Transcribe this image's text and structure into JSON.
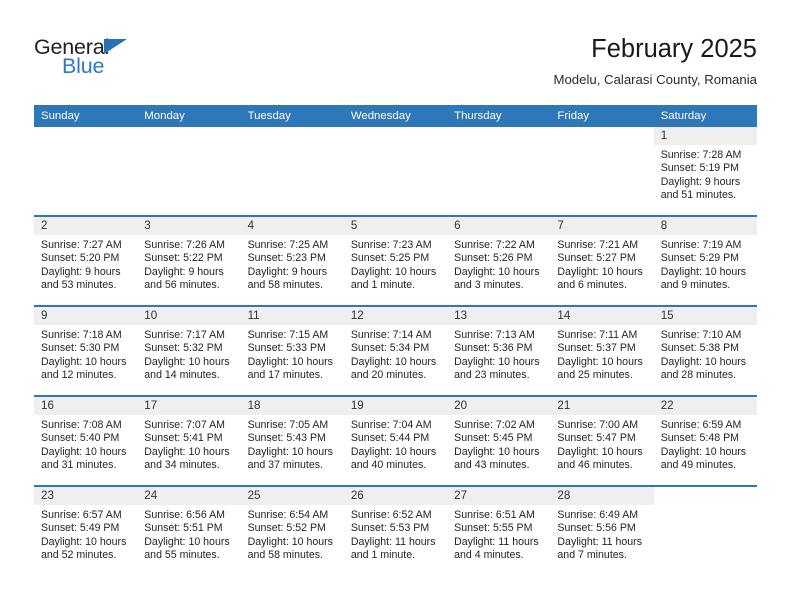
{
  "brand": {
    "word_dark": "General",
    "word_blue": "Blue",
    "accent_color": "#2e77b9",
    "logo_icon": "triangle-icon"
  },
  "header": {
    "title": "February 2025",
    "subtitle": "Modelu, Calarasi County, Romania"
  },
  "calendar": {
    "weekday_headers": [
      "Sunday",
      "Monday",
      "Tuesday",
      "Wednesday",
      "Thursday",
      "Friday",
      "Saturday"
    ],
    "header_bg": "#2e77b9",
    "daynum_band_bg": "#efefef",
    "weeks": [
      [
        {
          "day": "",
          "blank": true
        },
        {
          "day": "",
          "blank": true
        },
        {
          "day": "",
          "blank": true
        },
        {
          "day": "",
          "blank": true
        },
        {
          "day": "",
          "blank": true
        },
        {
          "day": "",
          "blank": true
        },
        {
          "day": "1",
          "sunrise": "Sunrise: 7:28 AM",
          "sunset": "Sunset: 5:19 PM",
          "daylight1": "Daylight: 9 hours",
          "daylight2": "and 51 minutes."
        }
      ],
      [
        {
          "day": "2",
          "sunrise": "Sunrise: 7:27 AM",
          "sunset": "Sunset: 5:20 PM",
          "daylight1": "Daylight: 9 hours",
          "daylight2": "and 53 minutes."
        },
        {
          "day": "3",
          "sunrise": "Sunrise: 7:26 AM",
          "sunset": "Sunset: 5:22 PM",
          "daylight1": "Daylight: 9 hours",
          "daylight2": "and 56 minutes."
        },
        {
          "day": "4",
          "sunrise": "Sunrise: 7:25 AM",
          "sunset": "Sunset: 5:23 PM",
          "daylight1": "Daylight: 9 hours",
          "daylight2": "and 58 minutes."
        },
        {
          "day": "5",
          "sunrise": "Sunrise: 7:23 AM",
          "sunset": "Sunset: 5:25 PM",
          "daylight1": "Daylight: 10 hours",
          "daylight2": "and 1 minute."
        },
        {
          "day": "6",
          "sunrise": "Sunrise: 7:22 AM",
          "sunset": "Sunset: 5:26 PM",
          "daylight1": "Daylight: 10 hours",
          "daylight2": "and 3 minutes."
        },
        {
          "day": "7",
          "sunrise": "Sunrise: 7:21 AM",
          "sunset": "Sunset: 5:27 PM",
          "daylight1": "Daylight: 10 hours",
          "daylight2": "and 6 minutes."
        },
        {
          "day": "8",
          "sunrise": "Sunrise: 7:19 AM",
          "sunset": "Sunset: 5:29 PM",
          "daylight1": "Daylight: 10 hours",
          "daylight2": "and 9 minutes."
        }
      ],
      [
        {
          "day": "9",
          "sunrise": "Sunrise: 7:18 AM",
          "sunset": "Sunset: 5:30 PM",
          "daylight1": "Daylight: 10 hours",
          "daylight2": "and 12 minutes."
        },
        {
          "day": "10",
          "sunrise": "Sunrise: 7:17 AM",
          "sunset": "Sunset: 5:32 PM",
          "daylight1": "Daylight: 10 hours",
          "daylight2": "and 14 minutes."
        },
        {
          "day": "11",
          "sunrise": "Sunrise: 7:15 AM",
          "sunset": "Sunset: 5:33 PM",
          "daylight1": "Daylight: 10 hours",
          "daylight2": "and 17 minutes."
        },
        {
          "day": "12",
          "sunrise": "Sunrise: 7:14 AM",
          "sunset": "Sunset: 5:34 PM",
          "daylight1": "Daylight: 10 hours",
          "daylight2": "and 20 minutes."
        },
        {
          "day": "13",
          "sunrise": "Sunrise: 7:13 AM",
          "sunset": "Sunset: 5:36 PM",
          "daylight1": "Daylight: 10 hours",
          "daylight2": "and 23 minutes."
        },
        {
          "day": "14",
          "sunrise": "Sunrise: 7:11 AM",
          "sunset": "Sunset: 5:37 PM",
          "daylight1": "Daylight: 10 hours",
          "daylight2": "and 25 minutes."
        },
        {
          "day": "15",
          "sunrise": "Sunrise: 7:10 AM",
          "sunset": "Sunset: 5:38 PM",
          "daylight1": "Daylight: 10 hours",
          "daylight2": "and 28 minutes."
        }
      ],
      [
        {
          "day": "16",
          "sunrise": "Sunrise: 7:08 AM",
          "sunset": "Sunset: 5:40 PM",
          "daylight1": "Daylight: 10 hours",
          "daylight2": "and 31 minutes."
        },
        {
          "day": "17",
          "sunrise": "Sunrise: 7:07 AM",
          "sunset": "Sunset: 5:41 PM",
          "daylight1": "Daylight: 10 hours",
          "daylight2": "and 34 minutes."
        },
        {
          "day": "18",
          "sunrise": "Sunrise: 7:05 AM",
          "sunset": "Sunset: 5:43 PM",
          "daylight1": "Daylight: 10 hours",
          "daylight2": "and 37 minutes."
        },
        {
          "day": "19",
          "sunrise": "Sunrise: 7:04 AM",
          "sunset": "Sunset: 5:44 PM",
          "daylight1": "Daylight: 10 hours",
          "daylight2": "and 40 minutes."
        },
        {
          "day": "20",
          "sunrise": "Sunrise: 7:02 AM",
          "sunset": "Sunset: 5:45 PM",
          "daylight1": "Daylight: 10 hours",
          "daylight2": "and 43 minutes."
        },
        {
          "day": "21",
          "sunrise": "Sunrise: 7:00 AM",
          "sunset": "Sunset: 5:47 PM",
          "daylight1": "Daylight: 10 hours",
          "daylight2": "and 46 minutes."
        },
        {
          "day": "22",
          "sunrise": "Sunrise: 6:59 AM",
          "sunset": "Sunset: 5:48 PM",
          "daylight1": "Daylight: 10 hours",
          "daylight2": "and 49 minutes."
        }
      ],
      [
        {
          "day": "23",
          "sunrise": "Sunrise: 6:57 AM",
          "sunset": "Sunset: 5:49 PM",
          "daylight1": "Daylight: 10 hours",
          "daylight2": "and 52 minutes."
        },
        {
          "day": "24",
          "sunrise": "Sunrise: 6:56 AM",
          "sunset": "Sunset: 5:51 PM",
          "daylight1": "Daylight: 10 hours",
          "daylight2": "and 55 minutes."
        },
        {
          "day": "25",
          "sunrise": "Sunrise: 6:54 AM",
          "sunset": "Sunset: 5:52 PM",
          "daylight1": "Daylight: 10 hours",
          "daylight2": "and 58 minutes."
        },
        {
          "day": "26",
          "sunrise": "Sunrise: 6:52 AM",
          "sunset": "Sunset: 5:53 PM",
          "daylight1": "Daylight: 11 hours",
          "daylight2": "and 1 minute."
        },
        {
          "day": "27",
          "sunrise": "Sunrise: 6:51 AM",
          "sunset": "Sunset: 5:55 PM",
          "daylight1": "Daylight: 11 hours",
          "daylight2": "and 4 minutes."
        },
        {
          "day": "28",
          "sunrise": "Sunrise: 6:49 AM",
          "sunset": "Sunset: 5:56 PM",
          "daylight1": "Daylight: 11 hours",
          "daylight2": "and 7 minutes."
        },
        {
          "day": "",
          "blank": true
        }
      ]
    ]
  }
}
